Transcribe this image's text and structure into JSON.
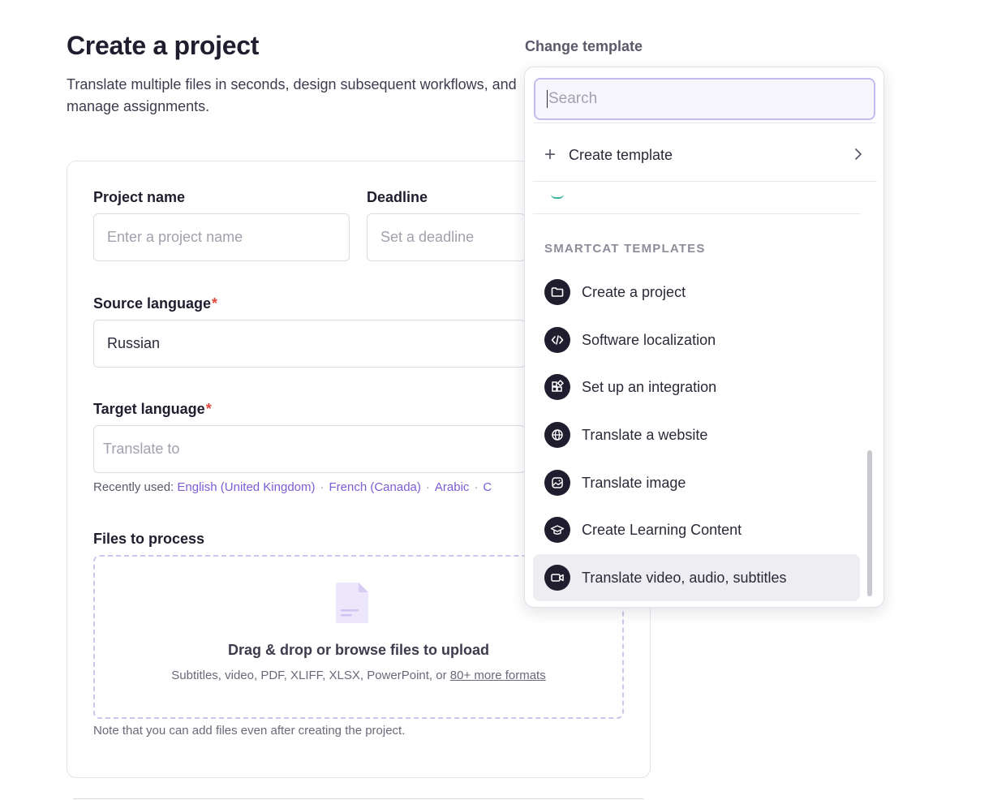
{
  "page": {
    "title": "Create a project",
    "description": "Translate multiple files in seconds, design subsequent workflows, and manage assignments."
  },
  "form": {
    "project_name_label": "Project name",
    "project_name_placeholder": "Enter a project name",
    "deadline_label": "Deadline",
    "deadline_placeholder": "Set a deadline",
    "source_language_label": "Source language",
    "source_language_value": "Russian",
    "target_language_label": "Target language",
    "target_language_placeholder": "Translate to",
    "required_mark": "*",
    "recently_used_label": "Recently used:",
    "recently_used": [
      "English (United Kingdom)",
      "French (Canada)",
      "Arabic",
      "C"
    ],
    "separator": "·",
    "files_label": "Files to process",
    "dropzone_title": "Drag & drop or browse files to upload",
    "dropzone_sub": "Subtitles, video, PDF, XLIFF, XLSX, PowerPoint, or",
    "dropzone_link": "80+ more formats",
    "note": "Note that you can add files even after creating the project."
  },
  "template_picker": {
    "label": "Change template",
    "search_placeholder": "Search",
    "create_template": "Create template",
    "section_title": "SMARTCAT TEMPLATES",
    "items": [
      {
        "label": "Create a project",
        "icon": "folder-icon"
      },
      {
        "label": "Software localization",
        "icon": "code-icon"
      },
      {
        "label": "Set up an integration",
        "icon": "integration-icon"
      },
      {
        "label": "Translate a website",
        "icon": "globe-icon"
      },
      {
        "label": "Translate image",
        "icon": "image-icon"
      },
      {
        "label": "Create Learning Content",
        "icon": "graduation-cap-icon"
      },
      {
        "label": "Translate video, audio, subtitles",
        "icon": "video-icon"
      }
    ],
    "selected_index": 6
  },
  "colors": {
    "accent": "#7c5cd6",
    "required": "#e2453c",
    "icon_bg": "#1f1d2e"
  }
}
